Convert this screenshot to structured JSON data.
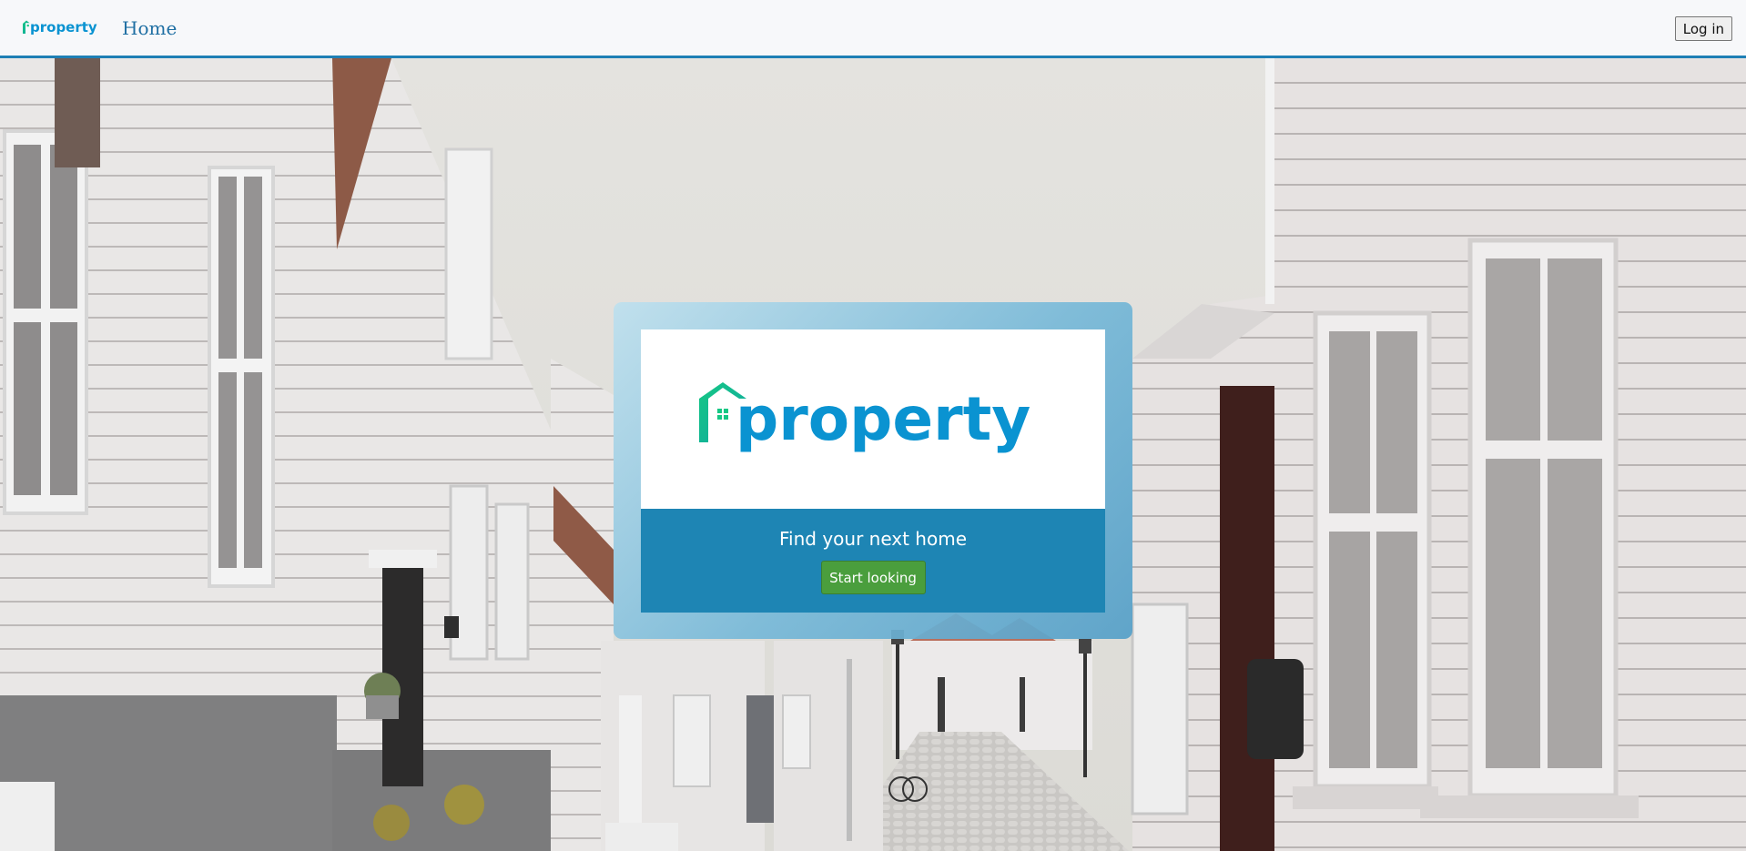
{
  "navbar": {
    "logo_text": "property",
    "home_label": "Home",
    "login_label": "Log in"
  },
  "hero": {
    "logo_text": "property",
    "tagline": "Find your next home",
    "cta_label": "Start looking"
  },
  "colors": {
    "brand_blue": "#0a93d1",
    "brand_green": "#16c784",
    "nav_border": "#1e7fb5",
    "panel_blue": "#1e85b4",
    "cta_green": "#4a9e3d"
  },
  "icons": [
    "house-roof-icon",
    "window-icon"
  ]
}
